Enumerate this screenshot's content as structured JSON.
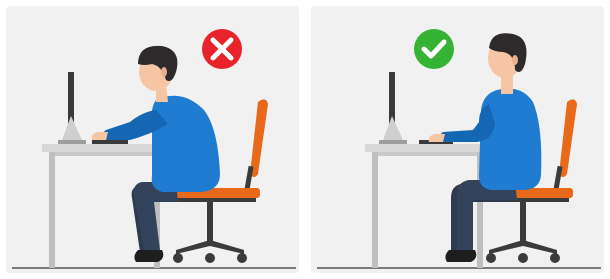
{
  "image": {
    "panels": [
      {
        "id": "incorrect",
        "status_icon": "cross-icon",
        "status_color": "#e8232a",
        "posture": "hunched"
      },
      {
        "id": "correct",
        "status_icon": "check-icon",
        "status_color": "#35b335",
        "posture": "upright"
      }
    ],
    "colors": {
      "panel_bg": "#f1f1f1",
      "desk_top": "#d7d7d7",
      "desk_legs": "#bfbfbf",
      "monitor": "#3a3a3a",
      "shirt": "#1f7cd1",
      "shirt_dark": "#1667b3",
      "pants": "#2d3a50",
      "skin": "#f6c6a4",
      "hair": "#2e2a2b",
      "chair_seat": "#e9691b",
      "chair_metal": "#3b3b3b",
      "floor": "#7a7a7a"
    }
  }
}
